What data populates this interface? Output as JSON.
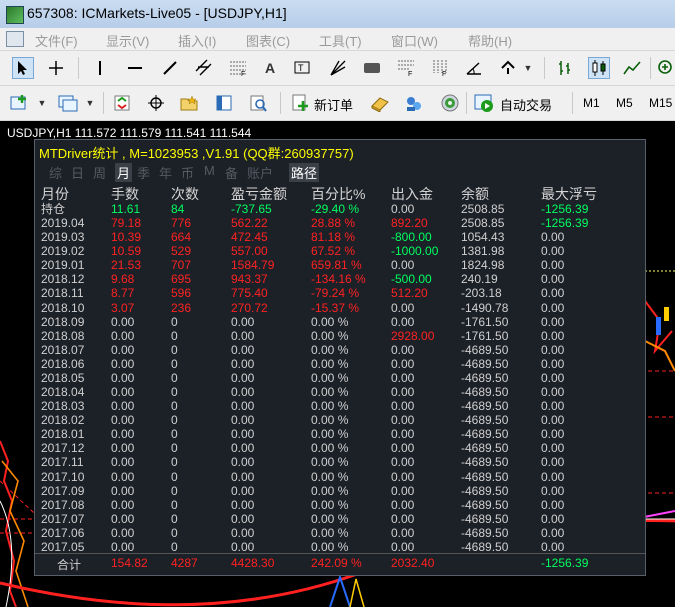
{
  "window": {
    "title": "657308: ICMarkets-Live05 - [USDJPY,H1]"
  },
  "menu": [
    "文件(F)",
    "显示(V)",
    "插入(I)",
    "图表(C)",
    "工具(T)",
    "窗口(W)",
    "帮助(H)"
  ],
  "toolbar2": {
    "new_order": "新订单",
    "auto_trade": "自动交易",
    "tf": [
      "M1",
      "M5",
      "M15"
    ]
  },
  "chart": {
    "symbol_line": "USDJPY,H1  111.572 111.579 111.541 111.544"
  },
  "panel": {
    "title": "MTDriver统计 , M=1023953 ,V1.91 (QQ群:260937757)",
    "tabs": [
      "综",
      "日",
      "周",
      "月",
      "季",
      "年",
      "币",
      "M",
      "备",
      "账户",
      "路径"
    ],
    "active_tab": "月",
    "headers": [
      "月份",
      "手数",
      "次数",
      "盈亏金额",
      "百分比%",
      "出入金",
      "余额",
      "最大浮亏"
    ],
    "rows": [
      [
        "持仓",
        "11.61",
        "84",
        "-737.65",
        "-29.40 %",
        "0.00",
        "2508.85",
        "-1256.39"
      ],
      [
        "2019.04",
        "79.18",
        "776",
        "562.22",
        "28.88 %",
        "892.20",
        "2508.85",
        "-1256.39"
      ],
      [
        "2019.03",
        "10.39",
        "664",
        "472.45",
        "81.18 %",
        "-800.00",
        "1054.43",
        "0.00"
      ],
      [
        "2019.02",
        "10.59",
        "529",
        "557.00",
        "67.52 %",
        "-1000.00",
        "1381.98",
        "0.00"
      ],
      [
        "2019.01",
        "21.53",
        "707",
        "1584.79",
        "659.81 %",
        "0.00",
        "1824.98",
        "0.00"
      ],
      [
        "2018.12",
        "9.68",
        "695",
        "943.37",
        "-134.16 %",
        "-500.00",
        "240.19",
        "0.00"
      ],
      [
        "2018.11",
        "8.77",
        "596",
        "775.40",
        "-79.24 %",
        "512.20",
        "-203.18",
        "0.00"
      ],
      [
        "2018.10",
        "3.07",
        "236",
        "270.72",
        "-15.37 %",
        "0.00",
        "-1490.78",
        "0.00"
      ],
      [
        "2018.09",
        "0.00",
        "0",
        "0.00",
        "0.00 %",
        "0.00",
        "-1761.50",
        "0.00"
      ],
      [
        "2018.08",
        "0.00",
        "0",
        "0.00",
        "0.00 %",
        "2928.00",
        "-1761.50",
        "0.00"
      ],
      [
        "2018.07",
        "0.00",
        "0",
        "0.00",
        "0.00 %",
        "0.00",
        "-4689.50",
        "0.00"
      ],
      [
        "2018.06",
        "0.00",
        "0",
        "0.00",
        "0.00 %",
        "0.00",
        "-4689.50",
        "0.00"
      ],
      [
        "2018.05",
        "0.00",
        "0",
        "0.00",
        "0.00 %",
        "0.00",
        "-4689.50",
        "0.00"
      ],
      [
        "2018.04",
        "0.00",
        "0",
        "0.00",
        "0.00 %",
        "0.00",
        "-4689.50",
        "0.00"
      ],
      [
        "2018.03",
        "0.00",
        "0",
        "0.00",
        "0.00 %",
        "0.00",
        "-4689.50",
        "0.00"
      ],
      [
        "2018.02",
        "0.00",
        "0",
        "0.00",
        "0.00 %",
        "0.00",
        "-4689.50",
        "0.00"
      ],
      [
        "2018.01",
        "0.00",
        "0",
        "0.00",
        "0.00 %",
        "0.00",
        "-4689.50",
        "0.00"
      ],
      [
        "2017.12",
        "0.00",
        "0",
        "0.00",
        "0.00 %",
        "0.00",
        "-4689.50",
        "0.00"
      ],
      [
        "2017.11",
        "0.00",
        "0",
        "0.00",
        "0.00 %",
        "0.00",
        "-4689.50",
        "0.00"
      ],
      [
        "2017.10",
        "0.00",
        "0",
        "0.00",
        "0.00 %",
        "0.00",
        "-4689.50",
        "0.00"
      ],
      [
        "2017.09",
        "0.00",
        "0",
        "0.00",
        "0.00 %",
        "0.00",
        "-4689.50",
        "0.00"
      ],
      [
        "2017.08",
        "0.00",
        "0",
        "0.00",
        "0.00 %",
        "0.00",
        "-4689.50",
        "0.00"
      ],
      [
        "2017.07",
        "0.00",
        "0",
        "0.00",
        "0.00 %",
        "0.00",
        "-4689.50",
        "0.00"
      ],
      [
        "2017.06",
        "0.00",
        "0",
        "0.00",
        "0.00 %",
        "0.00",
        "-4689.50",
        "0.00"
      ],
      [
        "2017.05",
        "0.00",
        "0",
        "0.00",
        "0.00 %",
        "0.00",
        "-4689.50",
        "0.00"
      ]
    ],
    "totals": [
      "合计",
      "154.82",
      "4287",
      "4428.30",
      "242.09 %",
      "2032.40",
      "",
      "-1256.39"
    ]
  },
  "colors": {
    "red": "#ff2222",
    "green": "#00ff60",
    "white": "#d0d0d0",
    "title_yellow": "#ffff00"
  }
}
